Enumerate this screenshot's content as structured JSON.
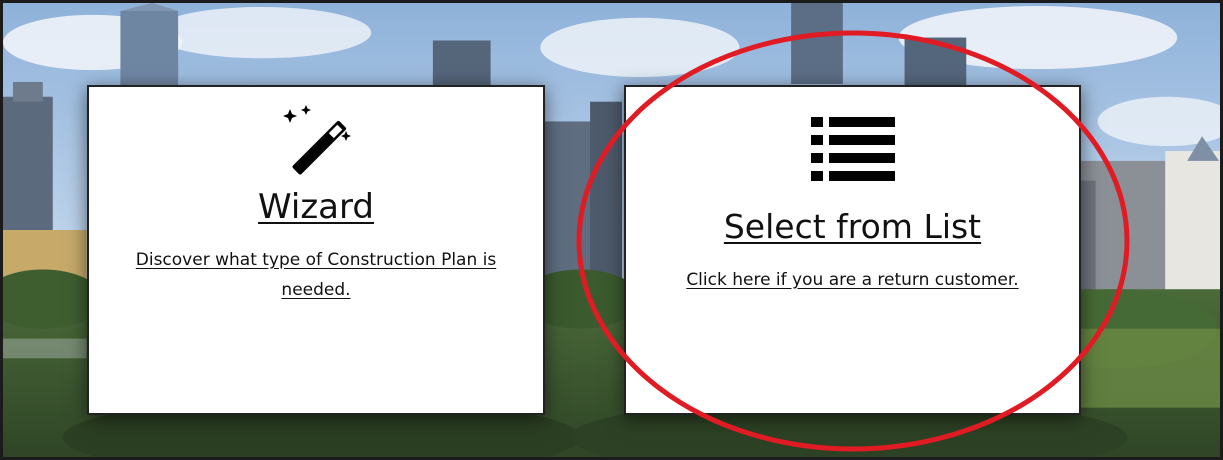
{
  "cards": [
    {
      "icon": "magic-wand-icon",
      "title": "Wizard",
      "description": "Discover what type of Construction Plan is needed."
    },
    {
      "icon": "list-icon",
      "title": "Select from List",
      "description": "Click here if you are a return customer."
    }
  ],
  "colors": {
    "annotation": "#e01b24",
    "text": "#111111",
    "card": "#ffffff",
    "sky": "#a9c5e3"
  }
}
